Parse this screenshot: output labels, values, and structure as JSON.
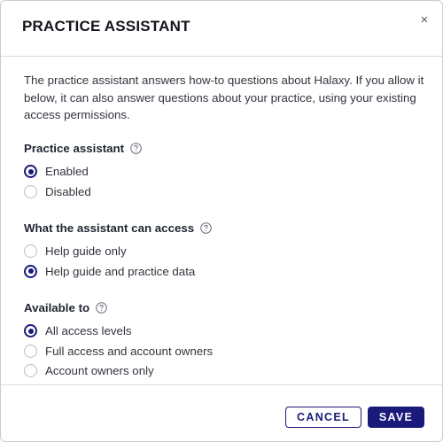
{
  "dialog": {
    "title": "PRACTICE ASSISTANT",
    "close_label": "×",
    "intro": "The practice assistant answers how-to questions about Halaxy. If you allow it below, it can also answer questions about your practice, using your existing access permissions."
  },
  "groups": [
    {
      "label": "Practice assistant",
      "help_icon": "question-circle-icon",
      "options": [
        {
          "label": "Enabled",
          "checked": true
        },
        {
          "label": "Disabled",
          "checked": false
        }
      ]
    },
    {
      "label": "What the assistant can access",
      "help_icon": "question-circle-icon",
      "options": [
        {
          "label": "Help guide only",
          "checked": false
        },
        {
          "label": "Help guide and practice data",
          "checked": true
        }
      ]
    },
    {
      "label": "Available to",
      "help_icon": "question-circle-icon",
      "options": [
        {
          "label": "All access levels",
          "checked": true
        },
        {
          "label": "Full access and account owners",
          "checked": false
        },
        {
          "label": "Account owners only",
          "checked": false
        }
      ]
    }
  ],
  "footer": {
    "cancel_label": "CANCEL",
    "save_label": "SAVE"
  },
  "colors": {
    "accent": "#1a1a7a",
    "border": "#d9dbe1",
    "text": "#30343e"
  }
}
